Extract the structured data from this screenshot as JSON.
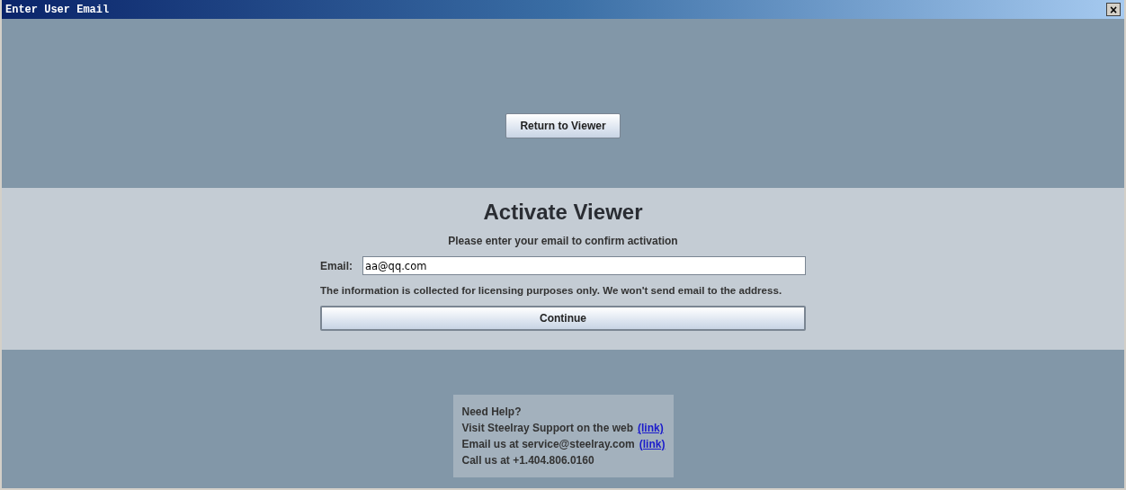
{
  "window": {
    "title": "Enter User Email",
    "close": "×"
  },
  "return_button": "Return to Viewer",
  "activation": {
    "heading": "Activate Viewer",
    "prompt": "Please enter your email to confirm activation",
    "email_label": "Email:",
    "email_value": "aa@qq.com",
    "note": "The information is collected for licensing purposes only. We won't send email to the address.",
    "continue_button": "Continue"
  },
  "help": [
    {
      "text": "Need Help?"
    },
    {
      "text": "Visit Steelray Support on the web",
      "link": "(link)"
    },
    {
      "text": "Email us at service@steelray.com",
      "link": "(link)"
    },
    {
      "text": "Call us at +1.404.806.0160"
    }
  ]
}
